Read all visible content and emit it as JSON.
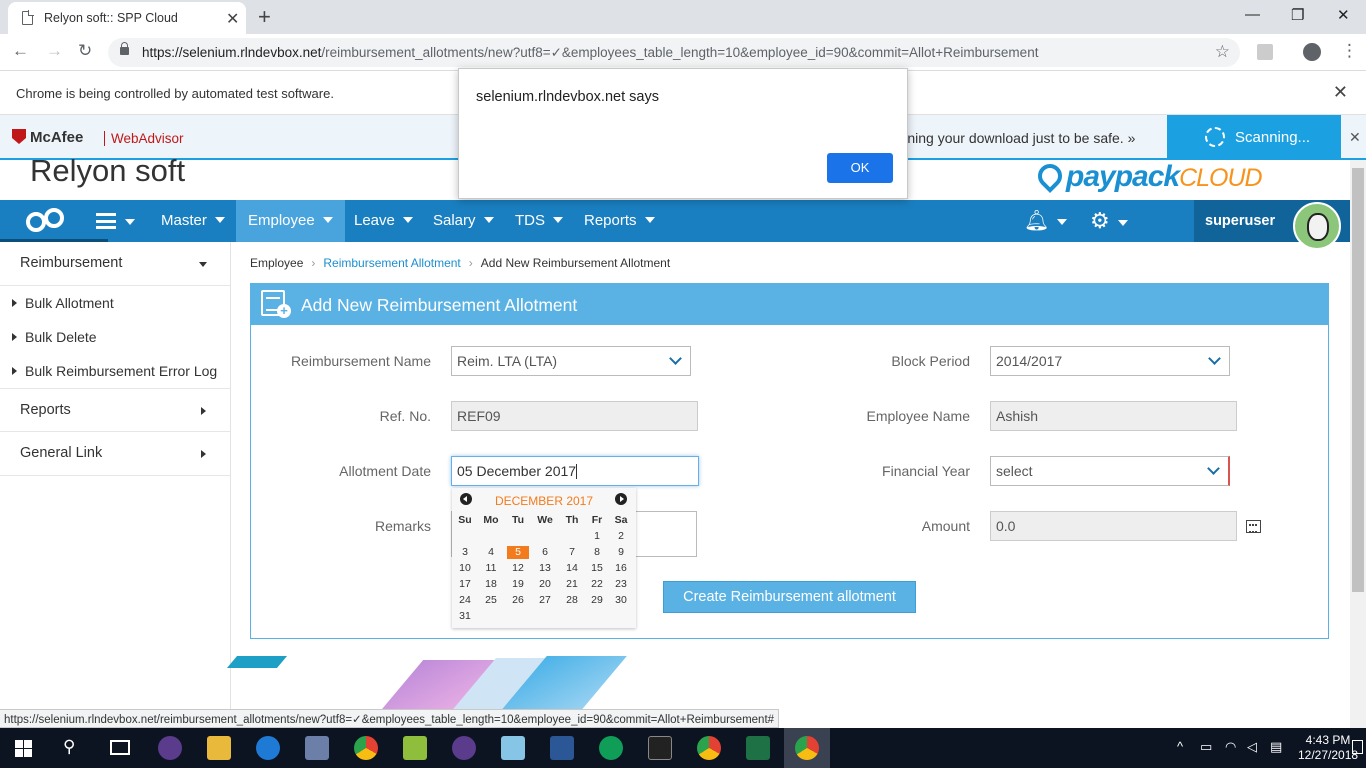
{
  "browser": {
    "tab_title": "Relyon soft:: SPP Cloud",
    "url_host": "https://selenium.rlndevbox.net",
    "url_path": "/reimbursement_allotments/new?utf8=✓&employees_table_length=10&employee_id=90&commit=Allot+Reimbursement",
    "automation_notice": "Chrome is being controlled by automated test software."
  },
  "alert": {
    "message": "selenium.rlndevbox.net says",
    "ok_label": "OK"
  },
  "mcafee": {
    "brand": "McAfee",
    "product": "WebAdvisor",
    "message": "We're scanning your download just to be safe. »",
    "status": "Scanning..."
  },
  "app": {
    "company": "Relyon soft",
    "product_logo": {
      "prefix": "pay",
      "main": "pack",
      "suffix": "CLOUD"
    },
    "user": "superuser"
  },
  "nav": {
    "items": [
      "Master",
      "Employee",
      "Leave",
      "Salary",
      "TDS",
      "Reports"
    ],
    "active": "Employee"
  },
  "sidebar": {
    "section": "Reimbursement",
    "sub_items": [
      "Bulk Allotment",
      "Bulk Delete",
      "Bulk Reimbursement Error Log"
    ],
    "others": [
      "Reports",
      "General Link"
    ]
  },
  "breadcrumb": [
    "Employee",
    "Reimbursement Allotment",
    "Add New Reimbursement Allotment"
  ],
  "form": {
    "title": "Add New Reimbursement Allotment",
    "reimbursement_name": {
      "label": "Reimbursement Name",
      "value": "Reim. LTA (LTA)"
    },
    "block_period": {
      "label": "Block Period",
      "value": "2014/2017"
    },
    "ref_no": {
      "label": "Ref. No.",
      "value": "REF09"
    },
    "employee_name": {
      "label": "Employee Name",
      "value": "Ashish"
    },
    "allotment_date": {
      "label": "Allotment Date",
      "value": "05 December 2017"
    },
    "financial_year": {
      "label": "Financial Year",
      "value": "select"
    },
    "remarks": {
      "label": "Remarks",
      "value": ""
    },
    "amount": {
      "label": "Amount",
      "value": "0.0"
    },
    "submit_label": "Create Reimbursement allotment"
  },
  "datepicker": {
    "month_title": "DECEMBER 2017",
    "weekdays": [
      "Su",
      "Mo",
      "Tu",
      "We",
      "Th",
      "Fr",
      "Sa"
    ],
    "weeks": [
      [
        "",
        "",
        "",
        "",
        "",
        "1",
        "2"
      ],
      [
        "3",
        "4",
        "5",
        "6",
        "7",
        "8",
        "9"
      ],
      [
        "10",
        "11",
        "12",
        "13",
        "14",
        "15",
        "16"
      ],
      [
        "17",
        "18",
        "19",
        "20",
        "21",
        "22",
        "23"
      ],
      [
        "24",
        "25",
        "26",
        "27",
        "28",
        "29",
        "30"
      ],
      [
        "31",
        "",
        "",
        "",
        "",
        "",
        ""
      ]
    ],
    "selected_day": "5"
  },
  "status_url": "https://selenium.rlndevbox.net/reimbursement_allotments/new?utf8=✓&employees_table_length=10&employee_id=90&commit=Allot+Reimbursement#",
  "taskbar": {
    "time": "4:43 PM",
    "date": "12/27/2018"
  }
}
